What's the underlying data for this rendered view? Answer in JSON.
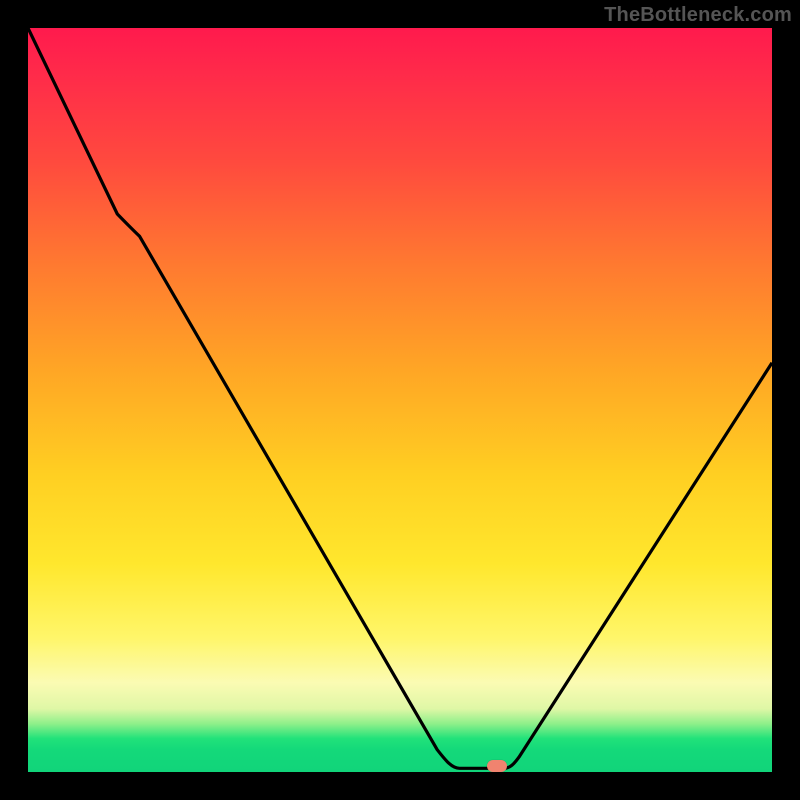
{
  "watermark": "TheBottleneck.com",
  "colors": {
    "background": "#000000",
    "curve": "#000000",
    "marker": "#f0836f",
    "gradient_stops": [
      "#ff1a4d",
      "#ff2a4a",
      "#ff4a3e",
      "#ff7a30",
      "#ffa625",
      "#ffcf22",
      "#ffe72d",
      "#fff66a",
      "#fbfbb3",
      "#dff7a6",
      "#8ff08a",
      "#21e27a",
      "#14d97a",
      "#11d47a"
    ]
  },
  "chart_data": {
    "type": "line",
    "title": "",
    "xlabel": "",
    "ylabel": "",
    "xlim": [
      0,
      100
    ],
    "ylim": [
      0,
      100
    ],
    "series": [
      {
        "name": "curve",
        "x": [
          0,
          12,
          15,
          55,
          58,
          64,
          66,
          100
        ],
        "values": [
          100,
          75,
          72,
          3,
          0.5,
          0.5,
          2,
          55
        ]
      }
    ],
    "marker": {
      "x": 63,
      "y": 0.5
    },
    "notes": "y=0 is green bottom, y=100 is red top; background is a vertical red→green heat gradient, curve is a black V reaching the bottom near x≈58–64 with a small salmon pill marker at the minimum."
  }
}
